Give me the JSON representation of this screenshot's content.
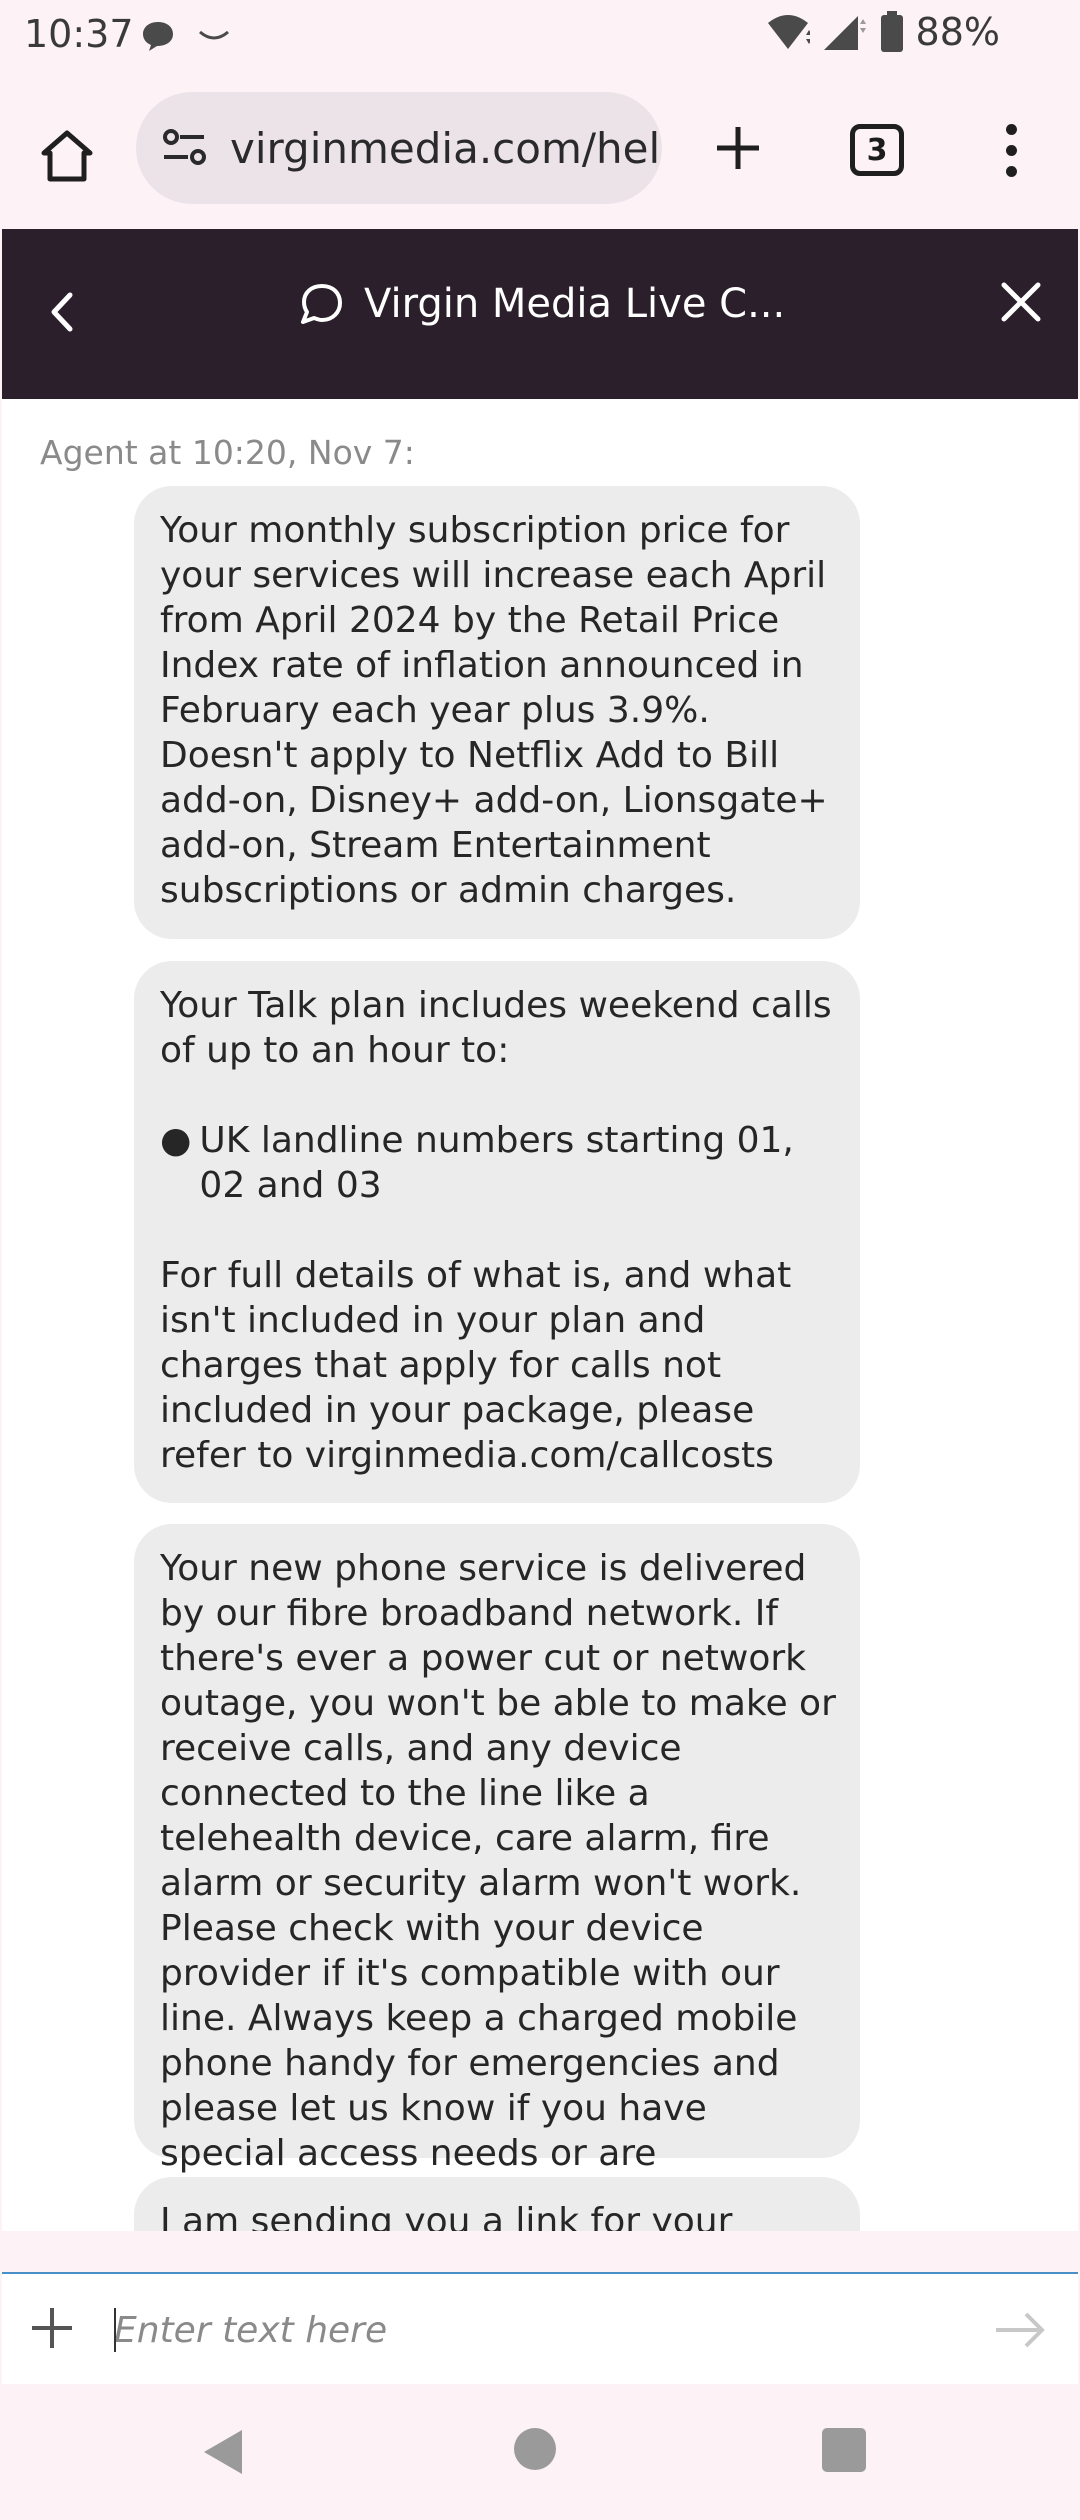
{
  "status_bar": {
    "time": "10:37",
    "battery": "88%",
    "icons": [
      "chat-bubble-icon",
      "smile-icon",
      "wifi-icon",
      "cell-signal-icon",
      "battery-icon"
    ]
  },
  "browser": {
    "url": "virginmedia.com/help",
    "tab_count": "3"
  },
  "chat_header": {
    "title": "Virgin Media Live C..."
  },
  "chat": {
    "agent_meta": "Agent at 10:20, Nov 7:",
    "messages": [
      {
        "paragraphs": [
          "Your monthly subscription price for your services will increase each April from April 2024 by the Retail Price Index rate of inflation announced in February each year plus 3.9%. Doesn't apply to Netflix Add to Bill add-on, Disney+ add-on, Lionsgate+ add-on, Stream Entertainment subscriptions or admin charges."
        ]
      },
      {
        "intro": "Your Talk plan includes weekend calls of up to an hour to:",
        "bullet": "UK landline numbers starting 01, 02 and 03",
        "outro": "For full details of what is, and what isn't included in your plan and charges that apply for calls not included in your package, please refer to virginmedia.com/callcosts"
      },
      {
        "paragraphs": [
          "Your new phone service is delivered by our fibre broadband network. If there's ever a power cut or network outage, you won't be able to make or receive calls, and any device connected to the line like a telehealth device, care alarm, fire alarm or security alarm won't work. Please check with your device provider if it's compatible with our line. Always keep a charged mobile phone handy for emergencies and please let us know if you have special access needs or are vulnerable."
        ]
      },
      {
        "paragraphs": [
          "I am sending you a link for your"
        ]
      }
    ]
  },
  "input": {
    "placeholder": "Enter text here"
  },
  "colors": {
    "header_bg": "#2a1f2a",
    "bubble_bg": "#ececec",
    "page_bg": "#fdf2f6",
    "input_focus": "#4a8fc7"
  }
}
